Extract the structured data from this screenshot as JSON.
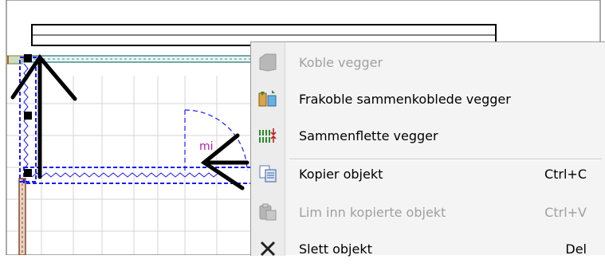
{
  "canvas": {
    "label_text": "mi"
  },
  "context_menu": {
    "items": [
      {
        "label": "Koble vegger",
        "shortcut": "",
        "disabled": true,
        "icon": "connect-walls-icon"
      },
      {
        "label": "Frakoble sammenkoblede vegger",
        "shortcut": "",
        "disabled": false,
        "icon": "disconnect-walls-icon"
      },
      {
        "label": "Sammenflette vegger",
        "shortcut": "",
        "disabled": false,
        "icon": "merge-walls-icon"
      },
      {
        "label": "Kopier objekt",
        "shortcut": "Ctrl+C",
        "disabled": false,
        "icon": "copy-icon"
      },
      {
        "label": "Lim inn kopierte objekt",
        "shortcut": "Ctrl+V",
        "disabled": true,
        "icon": "paste-icon"
      },
      {
        "label": "Slett objekt",
        "shortcut": "Del",
        "disabled": false,
        "icon": "delete-icon"
      }
    ]
  },
  "colors": {
    "selection": "#1a1aff",
    "wall_outline": "#000000",
    "grid": "#d3d3d3",
    "menu_bg": "#f4f4f4",
    "disabled_text": "#a0a0a0"
  }
}
